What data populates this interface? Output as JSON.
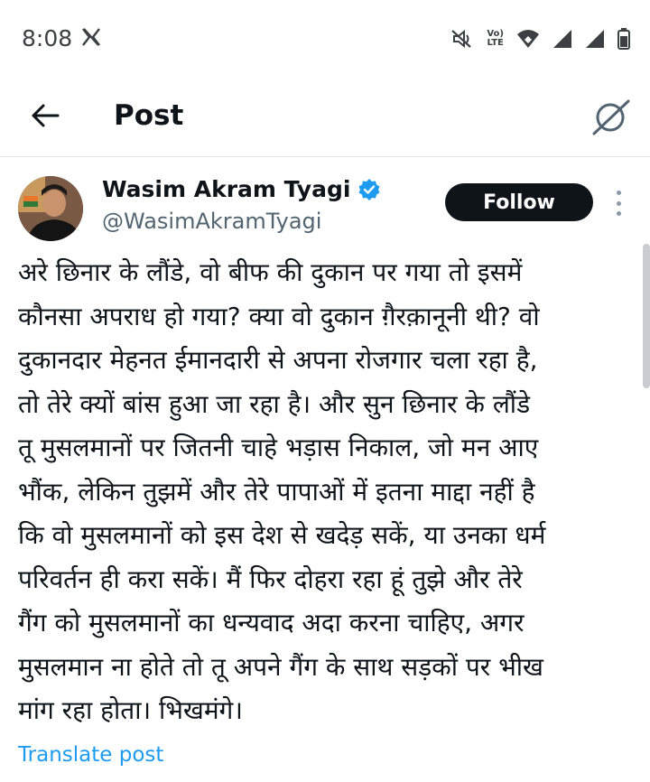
{
  "status_bar": {
    "time": "8:08",
    "x_logo_icon": "x-logo-icon",
    "icons": [
      "mute-icon",
      "volte-icon",
      "wifi-icon",
      "signal-icon",
      "signal-icon",
      "battery-icon"
    ],
    "volte_line1": "Vo)",
    "volte_line2": "LTE"
  },
  "header": {
    "title": "Post",
    "back_icon": "back-arrow-icon",
    "grok_icon": "grok-icon"
  },
  "post": {
    "author_name": "Wasim Akram Tyagi",
    "author_handle": "@WasimAkramTyagi",
    "follow_label": "Follow",
    "text_lines": [
      "अरे छिनार के लौंडे, वो बीफ की दुकान पर गया तो इसमें",
      "कौनसा अपराध हो गया? क्या वो दुकान ग़ैरक़ानूनी थी? वो",
      "दुकानदार मेहनत ईमानदारी से अपना रोजगार चला रहा है,",
      "तो तेरे क्यों बांस हुआ जा रहा है। और सुन छिनार के लौंडे",
      "तू मुसलमानों पर जितनी चाहे भड़ास निकाल, जो मन आए",
      "भौंक, लेकिन तुझमें और तेरे पापाओं में इतना माद्दा नहीं है",
      "कि वो मुसलमानों को इस देश से खदेड़ सकें, या उनका धर्म",
      "परिवर्तन ही करा सकें। मैं फिर दोहरा रहा हूं तुझे और तेरे",
      "गैंग को मुसलमानों का धन्यवाद अदा करना चाहिए, अगर",
      "मुसलमान ना होते तो तू अपने गैंग के साथ सड़कों पर भीख",
      "मांग रहा होता। भिखमंगे।"
    ],
    "translate_label": "Translate post",
    "colors": {
      "verified": "#1d9bf0",
      "link": "#1d9bf0",
      "follow_bg": "#0f1419"
    }
  }
}
